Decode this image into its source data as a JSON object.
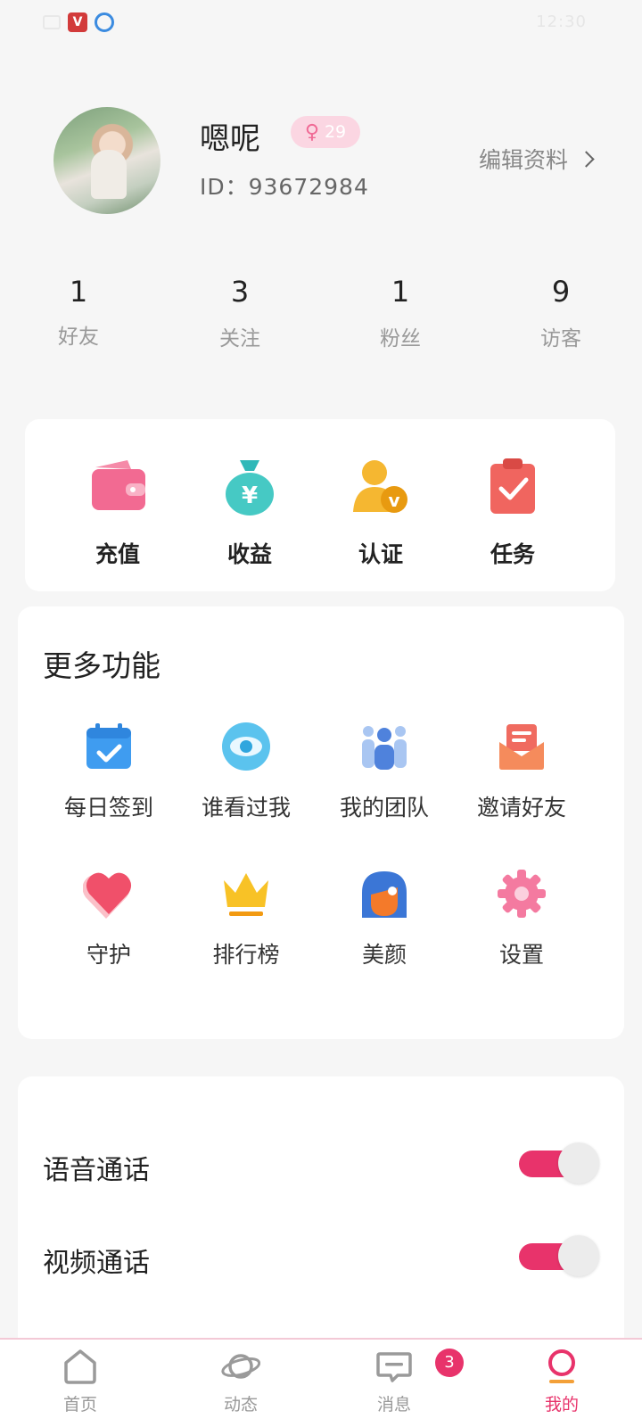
{
  "status_bar": {
    "time": "12:30"
  },
  "profile": {
    "name": "嗯呢",
    "gender_symbol": "♀",
    "age": "29",
    "id_text": "ID：93672984",
    "edit_label": "编辑资料"
  },
  "stats": [
    {
      "value": "1",
      "label": "好友"
    },
    {
      "value": "3",
      "label": "关注"
    },
    {
      "value": "1",
      "label": "粉丝"
    },
    {
      "value": "9",
      "label": "访客"
    }
  ],
  "quick_actions": [
    {
      "label": "充值",
      "icon": "wallet-icon"
    },
    {
      "label": "收益",
      "icon": "money-bag-icon"
    },
    {
      "label": "认证",
      "icon": "verify-user-icon"
    },
    {
      "label": "任务",
      "icon": "task-clipboard-icon"
    }
  ],
  "more_features": {
    "title": "更多功能",
    "items": [
      {
        "label": "每日签到",
        "icon": "calendar-check-icon"
      },
      {
        "label": "谁看过我",
        "icon": "eye-icon"
      },
      {
        "label": "我的团队",
        "icon": "team-icon"
      },
      {
        "label": "邀请好友",
        "icon": "envelope-icon"
      },
      {
        "label": "守护",
        "icon": "heart-icon"
      },
      {
        "label": "排行榜",
        "icon": "crown-icon"
      },
      {
        "label": "美颜",
        "icon": "beauty-face-icon"
      },
      {
        "label": "设置",
        "icon": "gear-icon"
      }
    ]
  },
  "settings_toggles": [
    {
      "label": "语音通话",
      "on": true
    },
    {
      "label": "视频通话",
      "on": true
    }
  ],
  "tab_bar": {
    "active_index": 3,
    "tabs": [
      {
        "label": "首页",
        "icon": "home-icon"
      },
      {
        "label": "动态",
        "icon": "planet-icon"
      },
      {
        "label": "消息",
        "icon": "message-icon",
        "badge": "3"
      },
      {
        "label": "我的",
        "icon": "profile-icon"
      }
    ]
  },
  "colors": {
    "accent": "#e8336b",
    "background": "#f6f6f6"
  }
}
